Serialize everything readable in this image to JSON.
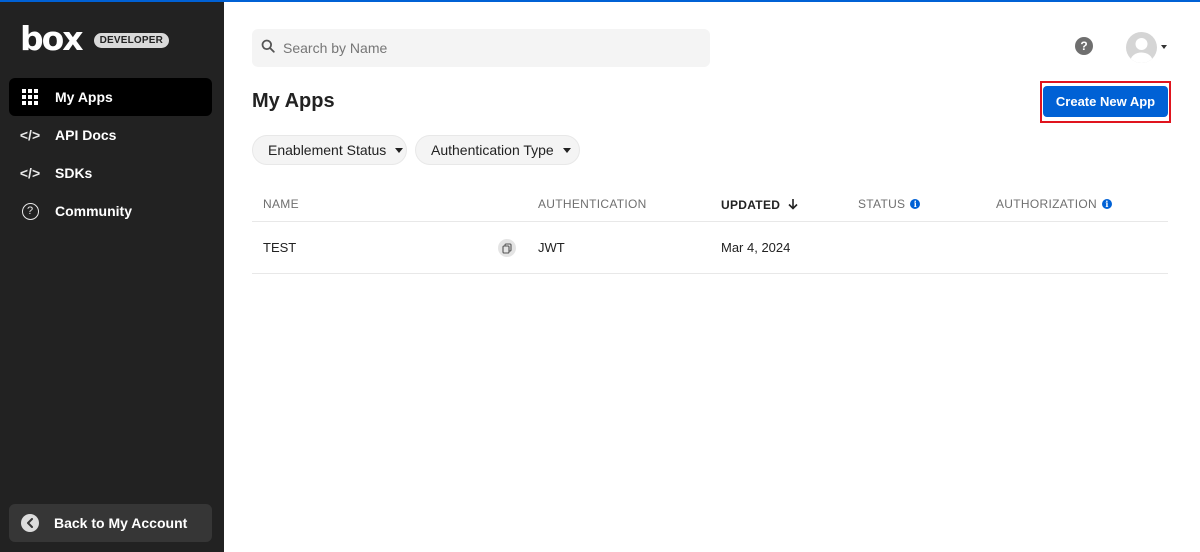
{
  "sidebar": {
    "logo": "box",
    "badge": "DEVELOPER",
    "items": [
      {
        "label": "My Apps",
        "icon": "grid-icon"
      },
      {
        "label": "API Docs",
        "icon": "code-icon"
      },
      {
        "label": "SDKs",
        "icon": "code-icon"
      },
      {
        "label": "Community",
        "icon": "question-icon"
      }
    ],
    "back": "Back to My Account"
  },
  "header": {
    "search_placeholder": "Search by Name"
  },
  "main": {
    "title": "My Apps",
    "create_button": "Create New App",
    "filters": [
      "Enablement Status",
      "Authentication Type"
    ],
    "columns": [
      "NAME",
      "AUTHENTICATION",
      "UPDATED",
      "STATUS",
      "AUTHORIZATION"
    ],
    "rows": [
      {
        "name": "TEST",
        "authentication": "JWT",
        "updated": "Mar 4, 2024",
        "status": "",
        "authorization": ""
      }
    ]
  },
  "colors": {
    "accent": "#0061d5",
    "sidebar_bg": "#222222",
    "highlight": "#e0141e"
  }
}
